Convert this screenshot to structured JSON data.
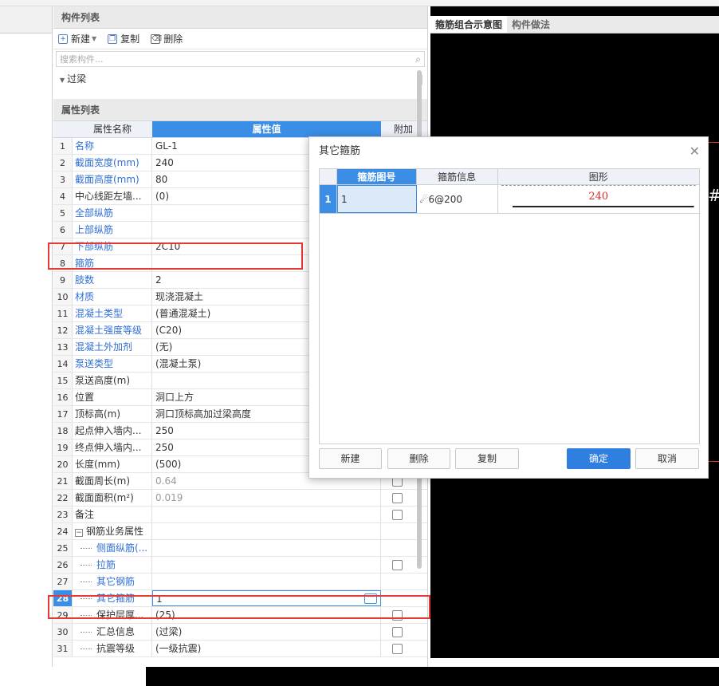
{
  "component_list": {
    "title": "构件列表",
    "new_label": "新建",
    "copy_label": "复制",
    "delete_label": "删除",
    "search_placeholder": "搜索构件...",
    "tree_node": "过梁"
  },
  "property_list": {
    "title": "属性列表",
    "col_name": "属性名称",
    "col_value": "属性值",
    "col_extra": "附加",
    "rows": [
      {
        "idx": "1",
        "name": "名称",
        "value": "GL-1",
        "name_color": "blue"
      },
      {
        "idx": "2",
        "name": "截面宽度(mm)",
        "value": "240",
        "name_color": "blue"
      },
      {
        "idx": "3",
        "name": "截面高度(mm)",
        "value": "80",
        "name_color": "blue"
      },
      {
        "idx": "4",
        "name": "中心线距左墙...",
        "value": "(0)",
        "name_color": "dark"
      },
      {
        "idx": "5",
        "name": "全部纵筋",
        "value": "",
        "name_color": "blue"
      },
      {
        "idx": "6",
        "name": "上部纵筋",
        "value": "",
        "name_color": "blue"
      },
      {
        "idx": "7",
        "name": "下部纵筋",
        "value": "2C10",
        "name_color": "blue"
      },
      {
        "idx": "8",
        "name": "箍筋",
        "value": "",
        "name_color": "blue"
      },
      {
        "idx": "9",
        "name": "肢数",
        "value": "2",
        "name_color": "blue"
      },
      {
        "idx": "10",
        "name": "材质",
        "value": "现浇混凝土",
        "name_color": "blue"
      },
      {
        "idx": "11",
        "name": "混凝土类型",
        "value": "(普通混凝土)",
        "name_color": "blue"
      },
      {
        "idx": "12",
        "name": "混凝土强度等级",
        "value": "(C20)",
        "name_color": "blue"
      },
      {
        "idx": "13",
        "name": "混凝土外加剂",
        "value": "(无)",
        "name_color": "blue"
      },
      {
        "idx": "14",
        "name": "泵送类型",
        "value": "(混凝土泵)",
        "name_color": "blue"
      },
      {
        "idx": "15",
        "name": "泵送高度(m)",
        "value": "",
        "name_color": "dark"
      },
      {
        "idx": "16",
        "name": "位置",
        "value": "洞口上方",
        "name_color": "dark"
      },
      {
        "idx": "17",
        "name": "顶标高(m)",
        "value": "洞口顶标高加过梁高度",
        "name_color": "dark"
      },
      {
        "idx": "18",
        "name": "起点伸入墙内...",
        "value": "250",
        "name_color": "dark"
      },
      {
        "idx": "19",
        "name": "终点伸入墙内...",
        "value": "250",
        "name_color": "dark"
      },
      {
        "idx": "20",
        "name": "长度(mm)",
        "value": "(500)",
        "name_color": "dark"
      },
      {
        "idx": "21",
        "name": "截面周长(m)",
        "value": "0.64",
        "name_color": "dark",
        "value_gray": true,
        "checkbox": true
      },
      {
        "idx": "22",
        "name": "截面面积(m²)",
        "value": "0.019",
        "name_color": "dark",
        "value_gray": true,
        "checkbox": true
      },
      {
        "idx": "23",
        "name": "备注",
        "value": "",
        "name_color": "dark",
        "checkbox": true
      },
      {
        "idx": "24",
        "name": "钢筋业务属性",
        "value": "",
        "name_color": "dark",
        "group": true
      },
      {
        "idx": "25",
        "name": "侧面纵筋(...",
        "value": "",
        "name_color": "blue",
        "indent": true
      },
      {
        "idx": "26",
        "name": "拉筋",
        "value": "",
        "name_color": "blue",
        "indent": true,
        "checkbox": true
      },
      {
        "idx": "27",
        "name": "其它钢筋",
        "value": "",
        "name_color": "blue",
        "indent": true
      },
      {
        "idx": "28",
        "name": "其它箍筋",
        "value": "1",
        "name_color": "blue",
        "indent": true,
        "active": true
      },
      {
        "idx": "29",
        "name": "保护层厚...",
        "value": "(25)",
        "name_color": "dark",
        "indent": true,
        "checkbox": true
      },
      {
        "idx": "30",
        "name": "汇总信息",
        "value": "(过梁)",
        "name_color": "dark",
        "indent": true,
        "checkbox": true
      },
      {
        "idx": "31",
        "name": "抗震等级",
        "value": "(一级抗震)",
        "name_color": "dark",
        "indent": true,
        "checkbox": true
      }
    ]
  },
  "right_tabs": {
    "tab1": "箍筋组合示意图",
    "tab2": "构件做法"
  },
  "dialog": {
    "title": "其它箍筋",
    "col_shape_no": "箍筋图号",
    "col_info": "箍筋信息",
    "col_figure": "图形",
    "row": {
      "idx": "1",
      "shape_no": "1",
      "info": "☄6@200",
      "figure_value": "240"
    },
    "btn_new": "新建",
    "btn_delete": "删除",
    "btn_copy": "复制",
    "btn_ok": "确定",
    "btn_cancel": "取消"
  },
  "colors": {
    "accent": "#3a8ee6",
    "highlight": "#e53935",
    "label_blue": "#2f6fd6"
  }
}
